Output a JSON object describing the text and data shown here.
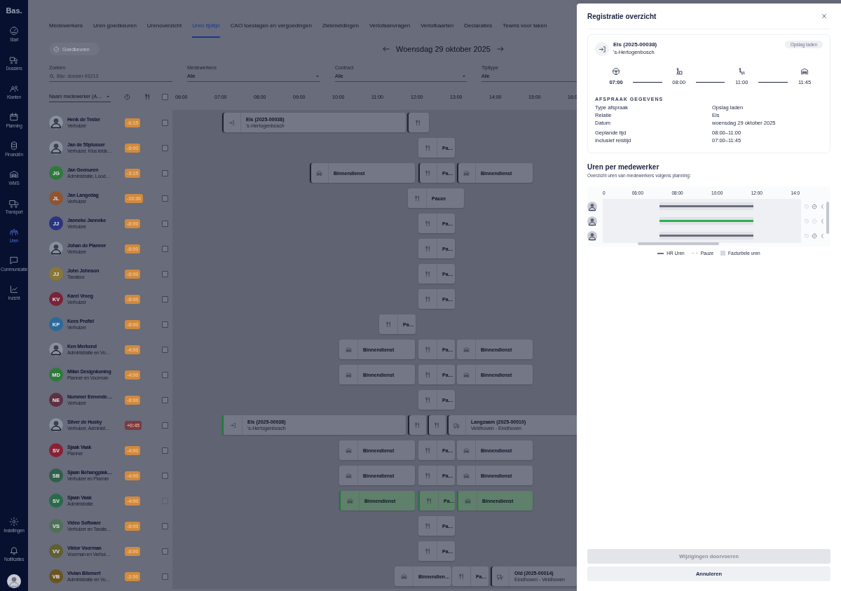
{
  "sidebar": {
    "logo": "Bas.",
    "items": [
      {
        "label": "Start",
        "selected": false
      },
      {
        "label": "Dossiers",
        "selected": false
      },
      {
        "label": "Klanten",
        "selected": false
      },
      {
        "label": "Planning",
        "selected": false
      },
      {
        "label": "Financiën",
        "selected": false
      },
      {
        "label": "WMS",
        "selected": false
      },
      {
        "label": "Transport",
        "selected": false
      },
      {
        "label": "Uren",
        "selected": true
      },
      {
        "label": "Communicatie",
        "selected": false
      },
      {
        "label": "Inzicht",
        "selected": false
      }
    ],
    "bottom_items": [
      "Instellingen",
      "Notificaties"
    ]
  },
  "tabs": [
    {
      "label": "Medewerkers",
      "selected": false
    },
    {
      "label": "Uren goedkeuren",
      "selected": false
    },
    {
      "label": "Urenoverzicht",
      "selected": false
    },
    {
      "label": "Uren tijdlijn",
      "selected": true
    },
    {
      "label": "CAO toeslagen en vergoedingen",
      "selected": false
    },
    {
      "label": "Ziekmeldingen",
      "selected": false
    },
    {
      "label": "Verlofaanvragen",
      "selected": false
    },
    {
      "label": "Verlofkaarten",
      "selected": false
    },
    {
      "label": "Declaraties",
      "selected": false
    },
    {
      "label": "Teams voor taken",
      "selected": false
    }
  ],
  "approve_button": {
    "label": "Goedkeuren",
    "disabled": true
  },
  "date": "Woensdag 29 oktober 2025",
  "filters": [
    {
      "kind": "search",
      "label": "Zoeken",
      "placeholder": "Bijv: dossier #3213"
    },
    {
      "kind": "select",
      "label": "Medewerkers",
      "value": "Alle"
    },
    {
      "kind": "select",
      "label": "Contract",
      "value": "Alle"
    },
    {
      "kind": "select",
      "label": "Tijdtype",
      "value": "Alle"
    }
  ],
  "table": {
    "sort": "Naam medewerker (A…",
    "select_all": {
      "checked": false
    },
    "hours": [
      "06:00",
      "07:00",
      "08:00",
      "09:00",
      "10:00",
      "11:00",
      "12:00",
      "13:00",
      "14:00",
      "15:00",
      "16:0"
    ],
    "rows": [
      {
        "name": "Henk de Tester",
        "role": "Verhuizer",
        "avatar": {
          "kind": "photo"
        },
        "balance": {
          "text": "-0:15",
          "color": "#d08a3e"
        },
        "checked": false,
        "disabled": false,
        "blocks": [
          {
            "kind": "job",
            "title": "Els (2025-00038)",
            "subtitle": "'s-Hertogenbosch",
            "flagged": true,
            "approved": false,
            "highlighted": false
          },
          {
            "kind": "pause",
            "flagged": true,
            "approved": false,
            "highlighted": false
          }
        ]
      },
      {
        "name": "Jan de 50plusser",
        "role": "Verhuizer, Klus leide…",
        "avatar": {
          "kind": "photo"
        },
        "balance": {
          "text": "-8:00",
          "color": "#d08a3e"
        },
        "checked": false,
        "disabled": false,
        "blocks": [
          {
            "kind": "pause",
            "title": "Pa…",
            "flagged": false,
            "approved": false,
            "highlighted": false
          }
        ]
      },
      {
        "name": "Jan Geenuren",
        "role": "Administratie, Lood…",
        "avatar": {
          "kind": "initials",
          "initials": "JG",
          "color": "#2f7a3a"
        },
        "balance": {
          "text": "-3:15",
          "color": "#d08a3e"
        },
        "checked": false,
        "disabled": false,
        "blocks": [
          {
            "kind": "office",
            "title": "Binnendienst",
            "flagged": true,
            "approved": false,
            "highlighted": false
          },
          {
            "kind": "pause",
            "title": "Pa…",
            "flagged": true,
            "approved": false,
            "highlighted": false
          },
          {
            "kind": "office",
            "title": "Binnendienst",
            "flagged": true,
            "approved": false,
            "highlighted": false
          }
        ]
      },
      {
        "name": "Jan Langedag",
        "role": "Verhuizer",
        "avatar": {
          "kind": "initials",
          "initials": "JL",
          "color": "#8f5530"
        },
        "balance": {
          "text": "-10:30",
          "color": "#d08a3e"
        },
        "checked": false,
        "disabled": false,
        "blocks": [
          {
            "kind": "pause",
            "title": "Pauze",
            "flagged": false,
            "approved": false,
            "highlighted": false
          }
        ]
      },
      {
        "name": "Janneke Janneke",
        "role": "Verhuizer",
        "avatar": {
          "kind": "initials",
          "initials": "JJ",
          "color": "#2a3580"
        },
        "balance": {
          "text": "-8:00",
          "color": "#d08a3e"
        },
        "checked": false,
        "disabled": false,
        "blocks": [
          {
            "kind": "pause",
            "title": "Pa…",
            "flagged": false,
            "approved": false,
            "highlighted": false
          }
        ]
      },
      {
        "name": "Johan de Planner",
        "role": "Verhuizer",
        "avatar": {
          "kind": "photo"
        },
        "balance": {
          "text": "-8:00",
          "color": "#d08a3e"
        },
        "checked": false,
        "disabled": false,
        "blocks": [
          {
            "kind": "pause",
            "title": "Pa…",
            "flagged": false,
            "approved": false,
            "highlighted": false
          }
        ]
      },
      {
        "name": "John Johnson",
        "role": "Taxateur",
        "avatar": {
          "kind": "initials",
          "initials": "JJ",
          "color": "#8a7635"
        },
        "balance": {
          "text": "-8:00",
          "color": "#d08a3e"
        },
        "checked": false,
        "disabled": false,
        "blocks": [
          {
            "kind": "pause",
            "title": "Pa…",
            "flagged": false,
            "approved": false,
            "highlighted": false
          }
        ]
      },
      {
        "name": "Karel Vroeg",
        "role": "Verhuizer",
        "avatar": {
          "kind": "initials",
          "initials": "KV",
          "color": "#7a2238"
        },
        "balance": {
          "text": "-8:00",
          "color": "#d08a3e"
        },
        "checked": false,
        "disabled": false,
        "blocks": [
          {
            "kind": "pause",
            "title": "Pa…",
            "flagged": false,
            "approved": false,
            "highlighted": false
          }
        ]
      },
      {
        "name": "Kees Profiel",
        "role": "Verhuizer",
        "avatar": {
          "kind": "initials",
          "initials": "KP",
          "color": "#2a6a9a"
        },
        "balance": {
          "text": "-8:00",
          "color": "#d08a3e"
        },
        "checked": false,
        "disabled": false,
        "blocks": [
          {
            "kind": "pause",
            "title": "Pa…",
            "flagged": false,
            "approved": false,
            "highlighted": false
          }
        ]
      },
      {
        "name": "Ken Merkend",
        "role": "Administratie en Vo…",
        "avatar": {
          "kind": "photo"
        },
        "balance": {
          "text": "-4:00",
          "color": "#d08a3e"
        },
        "checked": false,
        "disabled": false,
        "blocks": [
          {
            "kind": "office",
            "title": "Binnendienst",
            "flagged": false,
            "approved": false,
            "highlighted": false
          },
          {
            "kind": "pause",
            "title": "Pa…",
            "flagged": false,
            "approved": false,
            "highlighted": false
          },
          {
            "kind": "office",
            "title": "Binnendienst",
            "flagged": false,
            "approved": false,
            "highlighted": false
          }
        ]
      },
      {
        "name": "Milan Designkoning",
        "role": "Planner en Voorman",
        "avatar": {
          "kind": "initials",
          "initials": "MD",
          "color": "#2f7a3a"
        },
        "balance": {
          "text": "-4:00",
          "color": "#d08a3e"
        },
        "checked": false,
        "disabled": false,
        "blocks": [
          {
            "kind": "office",
            "title": "Binnendienst",
            "flagged": false,
            "approved": false,
            "highlighted": false
          },
          {
            "kind": "pause",
            "title": "Pa…",
            "flagged": false,
            "approved": false,
            "highlighted": false
          },
          {
            "kind": "office",
            "title": "Binnendienst",
            "flagged": false,
            "approved": false,
            "highlighted": false
          }
        ]
      },
      {
        "name": "Nummer Eenende…",
        "role": "Verhuizer",
        "avatar": {
          "kind": "initials",
          "initials": "NE",
          "color": "#5e3040"
        },
        "balance": {
          "text": "-8:00",
          "color": "#d08a3e"
        },
        "checked": false,
        "disabled": false,
        "blocks": [
          {
            "kind": "pause",
            "title": "Pa…",
            "flagged": false,
            "approved": false,
            "highlighted": false
          }
        ]
      },
      {
        "name": "Silver de Husky",
        "role": "Verhuizer, Administ…",
        "avatar": {
          "kind": "photo"
        },
        "balance": {
          "text": "+0:45",
          "color": "#7a3a46"
        },
        "checked": false,
        "disabled": false,
        "blocks": [
          {
            "kind": "job",
            "title": "Els (2025-00038)",
            "subtitle": "'s-Hertogenbosch",
            "flagged": false,
            "approved": true,
            "highlighted": false
          },
          {
            "kind": "pause",
            "flagged": true,
            "approved": false,
            "highlighted": false
          },
          {
            "kind": "pause",
            "flagged": true,
            "approved": false,
            "highlighted": false
          },
          {
            "kind": "transport",
            "title": "Langzaam (2025-00010)",
            "subtitle": "Veldhoven - Eindhoven",
            "flagged": true,
            "approved": false,
            "highlighted": false
          }
        ]
      },
      {
        "name": "Sjaak Vaak",
        "role": "Planner",
        "avatar": {
          "kind": "initials",
          "initials": "SV",
          "color": "#8a2035"
        },
        "balance": {
          "text": "-4:00",
          "color": "#d08a3e"
        },
        "checked": false,
        "disabled": false,
        "blocks": [
          {
            "kind": "office",
            "title": "Binnendienst",
            "flagged": false,
            "approved": false,
            "highlighted": false
          },
          {
            "kind": "pause",
            "title": "Pa…",
            "flagged": false,
            "approved": false,
            "highlighted": false
          },
          {
            "kind": "office",
            "title": "Binnendienst",
            "flagged": false,
            "approved": false,
            "highlighted": false
          }
        ]
      },
      {
        "name": "Sjaan Behangplak…",
        "role": "Verhuizer en Planner",
        "avatar": {
          "kind": "initials",
          "initials": "SB",
          "color": "#2f6048"
        },
        "balance": {
          "text": "-4:00",
          "color": "#d08a3e"
        },
        "checked": false,
        "disabled": false,
        "blocks": [
          {
            "kind": "office",
            "title": "Binnendienst",
            "flagged": false,
            "approved": false,
            "highlighted": false
          },
          {
            "kind": "pause",
            "title": "Pa…",
            "flagged": false,
            "approved": false,
            "highlighted": false
          },
          {
            "kind": "office",
            "title": "Binnendienst",
            "flagged": false,
            "approved": false,
            "highlighted": false
          }
        ]
      },
      {
        "name": "Sjaan Vaak",
        "role": "Administratie",
        "avatar": {
          "kind": "initials",
          "initials": "SV",
          "color": "#2a6a48"
        },
        "balance": {
          "text": "-4:00",
          "color": "#d08a3e"
        },
        "checked": false,
        "disabled": true,
        "blocks": [
          {
            "kind": "office",
            "title": "Binnendienst",
            "flagged": false,
            "approved": true,
            "highlighted": true
          },
          {
            "kind": "pause",
            "title": "Pa…",
            "flagged": false,
            "approved": true,
            "highlighted": true
          },
          {
            "kind": "office",
            "title": "Binnendienst",
            "flagged": false,
            "approved": true,
            "highlighted": true
          }
        ]
      },
      {
        "name": "Video Software",
        "role": "Verhuizer en Taxate…",
        "avatar": {
          "kind": "initials",
          "initials": "VS",
          "color": "#4f7058"
        },
        "balance": {
          "text": "-8:00",
          "color": "#d08a3e"
        },
        "checked": false,
        "disabled": false,
        "blocks": [
          {
            "kind": "pause",
            "title": "Pa…",
            "flagged": false,
            "approved": false,
            "highlighted": false
          }
        ]
      },
      {
        "name": "Viktor Voorman",
        "role": "Voorman en Verhui…",
        "avatar": {
          "kind": "initials",
          "initials": "VV",
          "color": "#5f5f30"
        },
        "balance": {
          "text": "-8:00",
          "color": "#d08a3e"
        },
        "checked": false,
        "disabled": false,
        "blocks": [
          {
            "kind": "pause",
            "title": "Pa…",
            "flagged": false,
            "approved": false,
            "highlighted": false
          }
        ]
      },
      {
        "name": "Vivian Bliemert",
        "role": "Administratie en Vo…",
        "avatar": {
          "kind": "initials",
          "initials": "VB",
          "color": "#6a5420"
        },
        "balance": {
          "text": "-2:00",
          "color": "#d08a3e"
        },
        "checked": false,
        "disabled": false,
        "blocks": [
          {
            "kind": "office",
            "title": "Binnendien…",
            "flagged": false,
            "approved": false,
            "highlighted": false
          },
          {
            "kind": "pause",
            "title": "Pa…",
            "flagged": false,
            "approved": false,
            "highlighted": false
          },
          {
            "kind": "transport",
            "title": "Old (2025-00014)",
            "subtitle": "Eindhoven - Veldhoven",
            "flagged": true,
            "approved": false,
            "highlighted": false
          }
        ]
      }
    ]
  },
  "drawer": {
    "title": "Registratie overzicht",
    "appointment": {
      "title": "Els (2025-00038)",
      "subtitle": "'s-Hertogenbosch",
      "tag": "Opslag laden",
      "steps": [
        {
          "time": "07:00",
          "active": true
        },
        {
          "time": "08:00",
          "active": false
        },
        {
          "time": "11:00",
          "active": false
        },
        {
          "time": "11:45",
          "active": false
        }
      ],
      "details_heading": "AFSPRAAK GEGEVENS",
      "details": [
        [
          {
            "label": "Type afspraak",
            "value": "Opslag laden"
          },
          {
            "label": "Relatie",
            "value": "Els"
          },
          {
            "label": "Datum",
            "value": "woensdag 29 oktober 2025"
          }
        ],
        [
          {
            "label": "Geplande tijd",
            "value": "08:00–11:00"
          },
          {
            "label": "Inclusief reistijd",
            "value": "07:00–11:45"
          }
        ]
      ]
    },
    "hours": {
      "title": "Uren per medewerker",
      "subtitle": "Overzicht uren van medewerkers volgens planning:",
      "ticks": [
        "0",
        "06:00",
        "08:00",
        "10:00",
        "12:00",
        "14:0"
      ],
      "rows": [
        {
          "approved": false,
          "confirmed": true
        },
        {
          "approved": true,
          "confirmed": false
        },
        {
          "approved": false,
          "confirmed": true
        }
      ],
      "legend": [
        "HR Uren",
        "Pauze",
        "Facturbele uren"
      ]
    },
    "buttons": [
      {
        "label": "Wijzigingen doorvoeren",
        "disabled": true
      },
      {
        "label": "Annuleren",
        "disabled": false
      }
    ]
  }
}
